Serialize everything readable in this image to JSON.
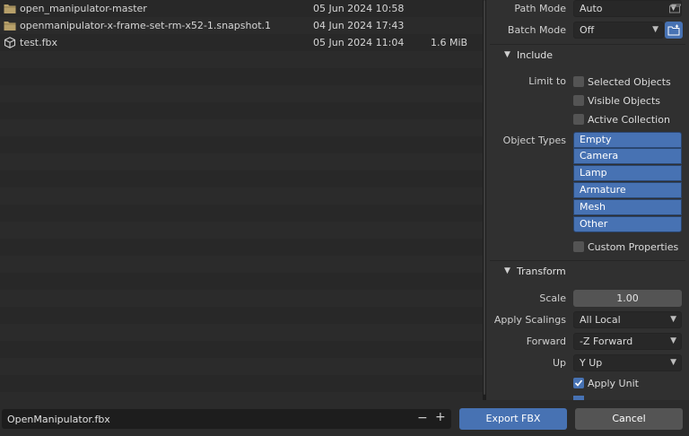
{
  "files": [
    {
      "name": "open_manipulator-master",
      "date": "05 Jun 2024 10:58",
      "size": "",
      "icon": "folder-icon"
    },
    {
      "name": "openmanipulator-x-frame-set-rm-x52-1.snapshot.1",
      "date": "04 Jun 2024 17:43",
      "size": "",
      "icon": "folder-icon"
    },
    {
      "name": "test.fbx",
      "date": "05 Jun 2024 11:04",
      "size": "1.6 MiB",
      "icon": "cube-icon"
    }
  ],
  "panel": {
    "path_mode": {
      "label": "Path Mode",
      "value": "Auto"
    },
    "batch_mode": {
      "label": "Batch Mode",
      "value": "Off"
    },
    "include": {
      "title": "Include",
      "limit_to_label": "Limit to",
      "selected_objects": "Selected Objects",
      "visible_objects": "Visible Objects",
      "active_collection": "Active Collection",
      "object_types_label": "Object Types",
      "object_types": [
        "Empty",
        "Camera",
        "Lamp",
        "Armature",
        "Mesh",
        "Other"
      ],
      "custom_properties": "Custom Properties"
    },
    "transform": {
      "title": "Transform",
      "scale_label": "Scale",
      "scale_value": "1.00",
      "apply_scalings_label": "Apply Scalings",
      "apply_scalings_value": "All Local",
      "forward_label": "Forward",
      "forward_value": "-Z Forward",
      "up_label": "Up",
      "up_value": "Y Up",
      "apply_unit": "Apply Unit"
    }
  },
  "bottom": {
    "filename": "OpenManipulator.fbx",
    "minus": "−",
    "plus": "+",
    "export_label": "Export FBX",
    "cancel_label": "Cancel"
  },
  "colors": {
    "accent": "#4772b3",
    "panel": "#303030",
    "list_bg": "#282828"
  }
}
